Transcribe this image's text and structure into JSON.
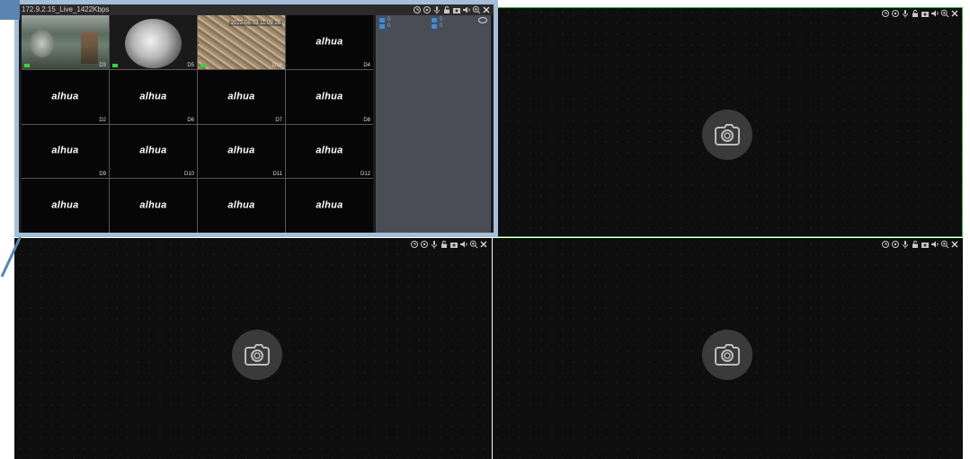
{
  "overlay": {
    "title": "172.9.2.15_Live_1422Kbps",
    "timestamp": "2022-08-03 11:09:28",
    "cells": [
      {
        "label": "D3",
        "feed": "live1"
      },
      {
        "label": "D5",
        "feed": "live2"
      },
      {
        "label": "D16",
        "feed": "live3"
      },
      {
        "label": "D4",
        "feed": "logo"
      },
      {
        "label": "D2",
        "feed": "logo"
      },
      {
        "label": "D6",
        "feed": "logo"
      },
      {
        "label": "D7",
        "feed": "logo"
      },
      {
        "label": "D8",
        "feed": "logo"
      },
      {
        "label": "D9",
        "feed": "logo"
      },
      {
        "label": "D10",
        "feed": "logo"
      },
      {
        "label": "D11",
        "feed": "logo"
      },
      {
        "label": "D12",
        "feed": "logo"
      },
      {
        "label": "",
        "feed": "logo"
      },
      {
        "label": "",
        "feed": "logo"
      },
      {
        "label": "",
        "feed": "logo"
      },
      {
        "label": "",
        "feed": "logo"
      }
    ],
    "brand_text": "alhua",
    "stats": {
      "people": "0",
      "vehicles": "0",
      "motion": "0",
      "line_cross": "0"
    }
  },
  "toolbar_icons": [
    "instant-replay-icon",
    "ptz-icon",
    "talk-icon",
    "lock-icon",
    "snapshot-icon",
    "audio-icon",
    "zoom-icon",
    "close-icon"
  ],
  "colors": {
    "active_border": "#3fae3f",
    "overlay_border": "#a6bfd8",
    "callout": "#5b84b1",
    "pane_bg": "#0e0e0e"
  }
}
